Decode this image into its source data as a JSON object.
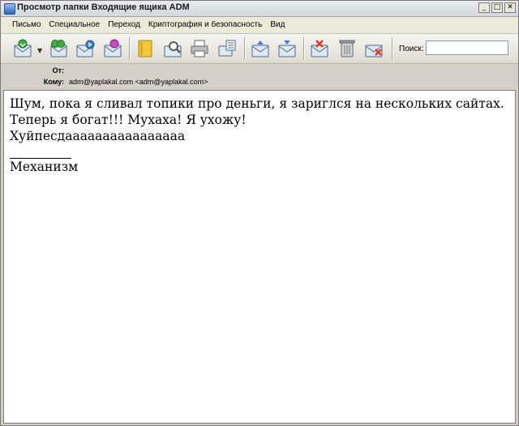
{
  "window": {
    "title": "Просмотр папки Входящие ящика ADM",
    "minimize": "_",
    "maximize": "□",
    "close": "✕"
  },
  "menu": [
    "Письмо",
    "Специальное",
    "Переход",
    "Криптография и безопасность",
    "Вид"
  ],
  "toolbar": {
    "icons": [
      "get-mail-icon",
      "reply-all-icon",
      "forward-icon",
      "move-icon",
      "address-book-icon",
      "find-icon",
      "print-icon",
      "print-preview-icon",
      "previous-message-icon",
      "next-message-icon",
      "mark-junk-icon",
      "delete-icon",
      "not-junk-icon"
    ],
    "dropdown_arrow": "▼",
    "search_label": "Поиск:",
    "search_value": ""
  },
  "header": {
    "from_label": "От:",
    "from_value": "",
    "to_label": "Кому:",
    "to_value": "adm@yaplakal.com <adm@yaplakal.com>"
  },
  "message": {
    "lines": [
      "Шум, пока я сливал топики про деньги, я зариглся на нескольких сайтах.",
      "Теперь я богат!!! Мухаха! Я ухожу!",
      "Хуйпесдаааааааааааааааа"
    ],
    "signature": "Механизм"
  },
  "colors": {
    "background": "#d4d0c8",
    "body": "#ffffff",
    "text": "#000000"
  }
}
